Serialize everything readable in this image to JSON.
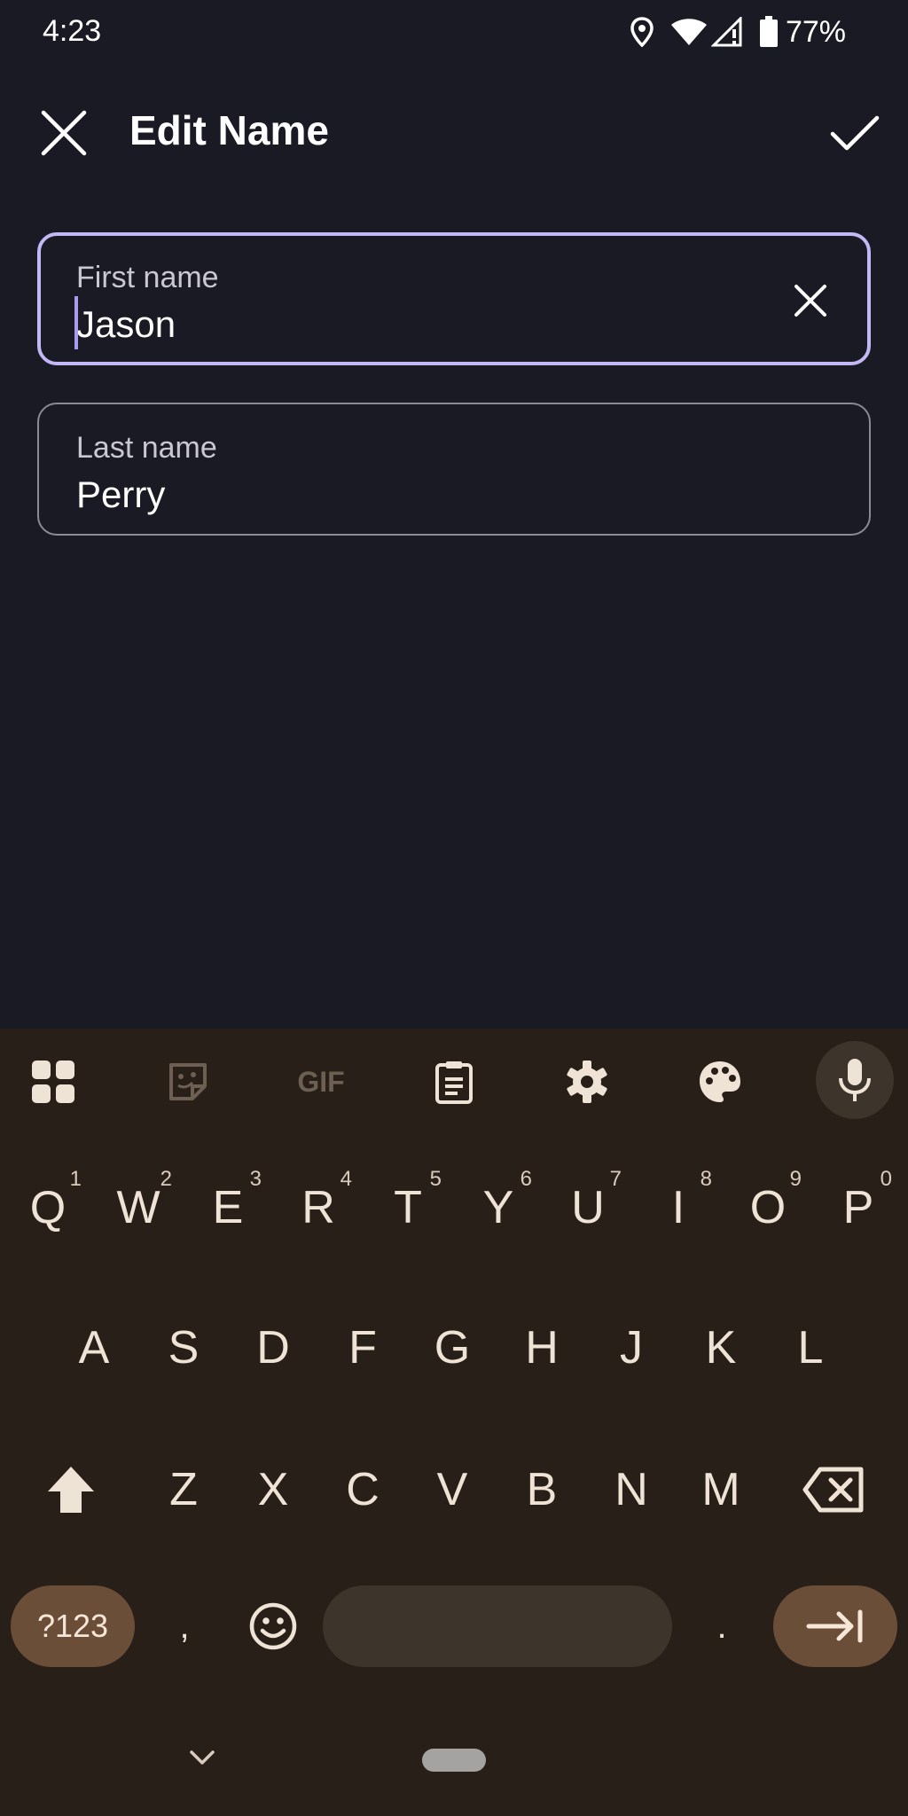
{
  "status_bar": {
    "time": "4:23",
    "battery": "77%",
    "icons": [
      "location-icon",
      "wifi-icon",
      "signal-icon",
      "battery-icon"
    ]
  },
  "app_bar": {
    "title": "Edit Name",
    "close_icon": "close-icon",
    "confirm_icon": "check-icon"
  },
  "fields": {
    "first_name": {
      "label": "First name",
      "value": "Jason"
    },
    "last_name": {
      "label": "Last name",
      "value": "Perry"
    }
  },
  "keyboard": {
    "toolbar": [
      "apps-grid-icon",
      "sticker-icon",
      "gif-icon",
      "clipboard-icon",
      "settings-icon",
      "palette-icon",
      "mic-icon"
    ],
    "toolbar_gif_label": "GIF",
    "row1": [
      {
        "key": "Q",
        "hint": "1"
      },
      {
        "key": "W",
        "hint": "2"
      },
      {
        "key": "E",
        "hint": "3"
      },
      {
        "key": "R",
        "hint": "4"
      },
      {
        "key": "T",
        "hint": "5"
      },
      {
        "key": "Y",
        "hint": "6"
      },
      {
        "key": "U",
        "hint": "7"
      },
      {
        "key": "I",
        "hint": "8"
      },
      {
        "key": "O",
        "hint": "9"
      },
      {
        "key": "P",
        "hint": "0"
      }
    ],
    "row2": [
      "A",
      "S",
      "D",
      "F",
      "G",
      "H",
      "J",
      "K",
      "L"
    ],
    "row3": [
      "Z",
      "X",
      "C",
      "V",
      "B",
      "N",
      "M"
    ],
    "symbols_label": "?123",
    "comma": ",",
    "period": ".",
    "colors": {
      "background": "#281f18",
      "accent_pill": "#6b4e38",
      "key_text": "#efe3d6"
    }
  },
  "colors": {
    "background": "#191a23",
    "focus_border": "#c3b8f5",
    "field_border": "#8b8a92"
  }
}
